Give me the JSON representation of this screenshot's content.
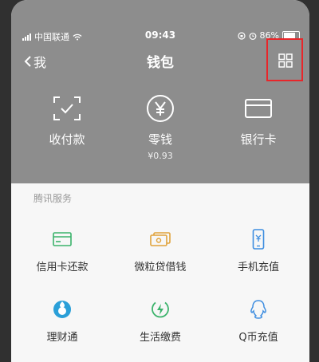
{
  "status_bar": {
    "carrier": "中国联通",
    "time": "09:43",
    "battery": "86%",
    "battery_level": 0.86
  },
  "nav": {
    "back_label": "我",
    "title": "钱包",
    "more_icon": "grid-icon"
  },
  "wallet": {
    "items": [
      {
        "label": "收付款",
        "icon": "scan-pay-icon"
      },
      {
        "label": "零钱",
        "sub": "¥0.93",
        "icon": "yuan-icon"
      },
      {
        "label": "银行卡",
        "icon": "bank-card-icon"
      }
    ]
  },
  "services": {
    "section_title": "腾讯服务",
    "items": [
      {
        "label": "信用卡还款",
        "icon": "credit-card-icon",
        "color": "#3bb36b"
      },
      {
        "label": "微粒贷借钱",
        "icon": "loan-icon",
        "color": "#e0a23a"
      },
      {
        "label": "手机充值",
        "icon": "phone-topup-icon",
        "color": "#3d8de0"
      },
      {
        "label": "理财通",
        "icon": "wealth-icon",
        "color": "#2a9fd8"
      },
      {
        "label": "生活缴费",
        "icon": "utility-icon",
        "color": "#3bb36b"
      },
      {
        "label": "Q币充值",
        "icon": "qq-coin-icon",
        "color": "#3d8de0"
      }
    ]
  },
  "colors": {
    "header_bg": "#8d8d8d",
    "highlight": "#e8262a",
    "body_bg": "#f7f7f7"
  }
}
